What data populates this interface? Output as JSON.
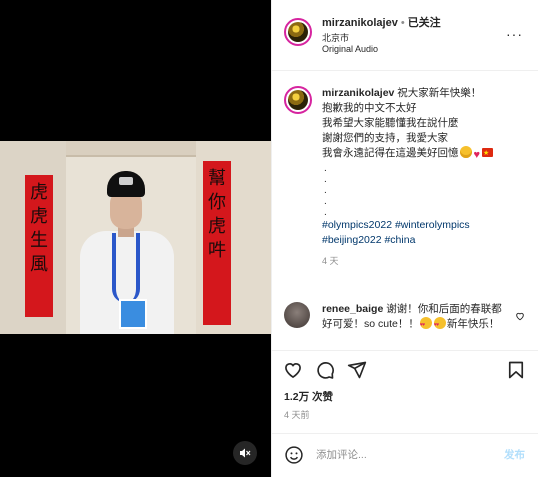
{
  "video": {
    "couplet_left": "虎虎生風",
    "couplet_right": "幫你虎吽"
  },
  "header": {
    "username": "mirzanikolajev",
    "separator": "•",
    "follow_label": "已关注",
    "location": "北京市",
    "audio": "Original Audio",
    "more_label": "···"
  },
  "caption": {
    "username": "mirzanikolajev",
    "first_line": "祝大家新年快樂！",
    "lines": [
      "抱歉我的中文不太好",
      "我希望大家能聽懂我在說什麼",
      "謝謝您們的支持，我愛大家",
      "我會永遠記得在這邊美好回憶"
    ],
    "dots": [
      ".",
      ".",
      ".",
      ".",
      "."
    ],
    "hashtags_line1": "#olympics2022 #winterolympics",
    "hashtags_line2": "#beijing2022 #china",
    "time": "4 天"
  },
  "comment": {
    "username": "renee_baige",
    "text_1": "谢谢！你和后面的春联都好可爱！so cute！！",
    "text_2": "新年快乐！"
  },
  "actions": {
    "icons": [
      "heart-icon",
      "comment-icon",
      "share-icon",
      "bookmark-icon"
    ]
  },
  "stats": {
    "likes": "1.2万 次赞",
    "ago": "4 天前"
  },
  "add_comment": {
    "placeholder": "添加评论...",
    "post_label": "发布"
  },
  "colors": {
    "link": "#00376b",
    "secondary_text": "#8e8e8e",
    "post_disabled": "#b2dffc",
    "story_ring": "#d6249f"
  }
}
